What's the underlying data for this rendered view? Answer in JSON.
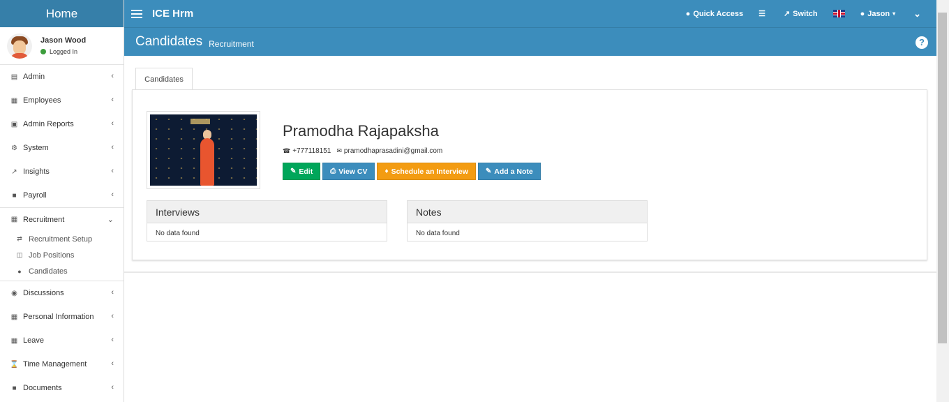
{
  "sidebar": {
    "brand": "Home",
    "user": {
      "name": "Jason Wood",
      "status": "Logged In"
    },
    "items": [
      {
        "label": "Admin",
        "icon": "cubes-icon"
      },
      {
        "label": "Employees",
        "icon": "grid-icon"
      },
      {
        "label": "Admin Reports",
        "icon": "cube-icon"
      },
      {
        "label": "System",
        "icon": "cogs-icon"
      },
      {
        "label": "Insights",
        "icon": "line-chart-icon"
      },
      {
        "label": "Payroll",
        "icon": "document-icon"
      },
      {
        "label": "Recruitment",
        "icon": "th-icon"
      }
    ],
    "recruitment_sub": [
      {
        "label": "Recruitment Setup",
        "icon": "random-icon"
      },
      {
        "label": "Job Positions",
        "icon": "columns-icon"
      },
      {
        "label": "Candidates",
        "icon": "users-icon"
      }
    ],
    "items_after": [
      {
        "label": "Discussions",
        "icon": "comments-icon"
      },
      {
        "label": "Personal Information",
        "icon": "grid-icon"
      },
      {
        "label": "Leave",
        "icon": "calendar-icon"
      },
      {
        "label": "Time Management",
        "icon": "hourglass-icon"
      },
      {
        "label": "Documents",
        "icon": "file-icon"
      }
    ]
  },
  "topbar": {
    "app_title": "ICE Hrm",
    "quick_access": "Quick Access",
    "switch": "Switch",
    "user_menu": "Jason"
  },
  "header": {
    "title": "Candidates",
    "subtitle": "Recruitment"
  },
  "tabs": [
    {
      "label": "Candidates"
    }
  ],
  "candidate": {
    "name": "Pramodha Rajapaksha",
    "phone": "+777118151",
    "email": "pramodhaprasadini@gmail.com"
  },
  "actions": {
    "edit": "Edit",
    "view_cv": "View CV",
    "schedule": "Schedule an Interview",
    "add_note": "Add a Note"
  },
  "panels": {
    "interviews": {
      "title": "Interviews",
      "empty": "No data found"
    },
    "notes": {
      "title": "Notes",
      "empty": "No data found"
    }
  },
  "colors": {
    "primary": "#3c8dbc",
    "success": "#00a65a",
    "warning": "#f39c12"
  }
}
